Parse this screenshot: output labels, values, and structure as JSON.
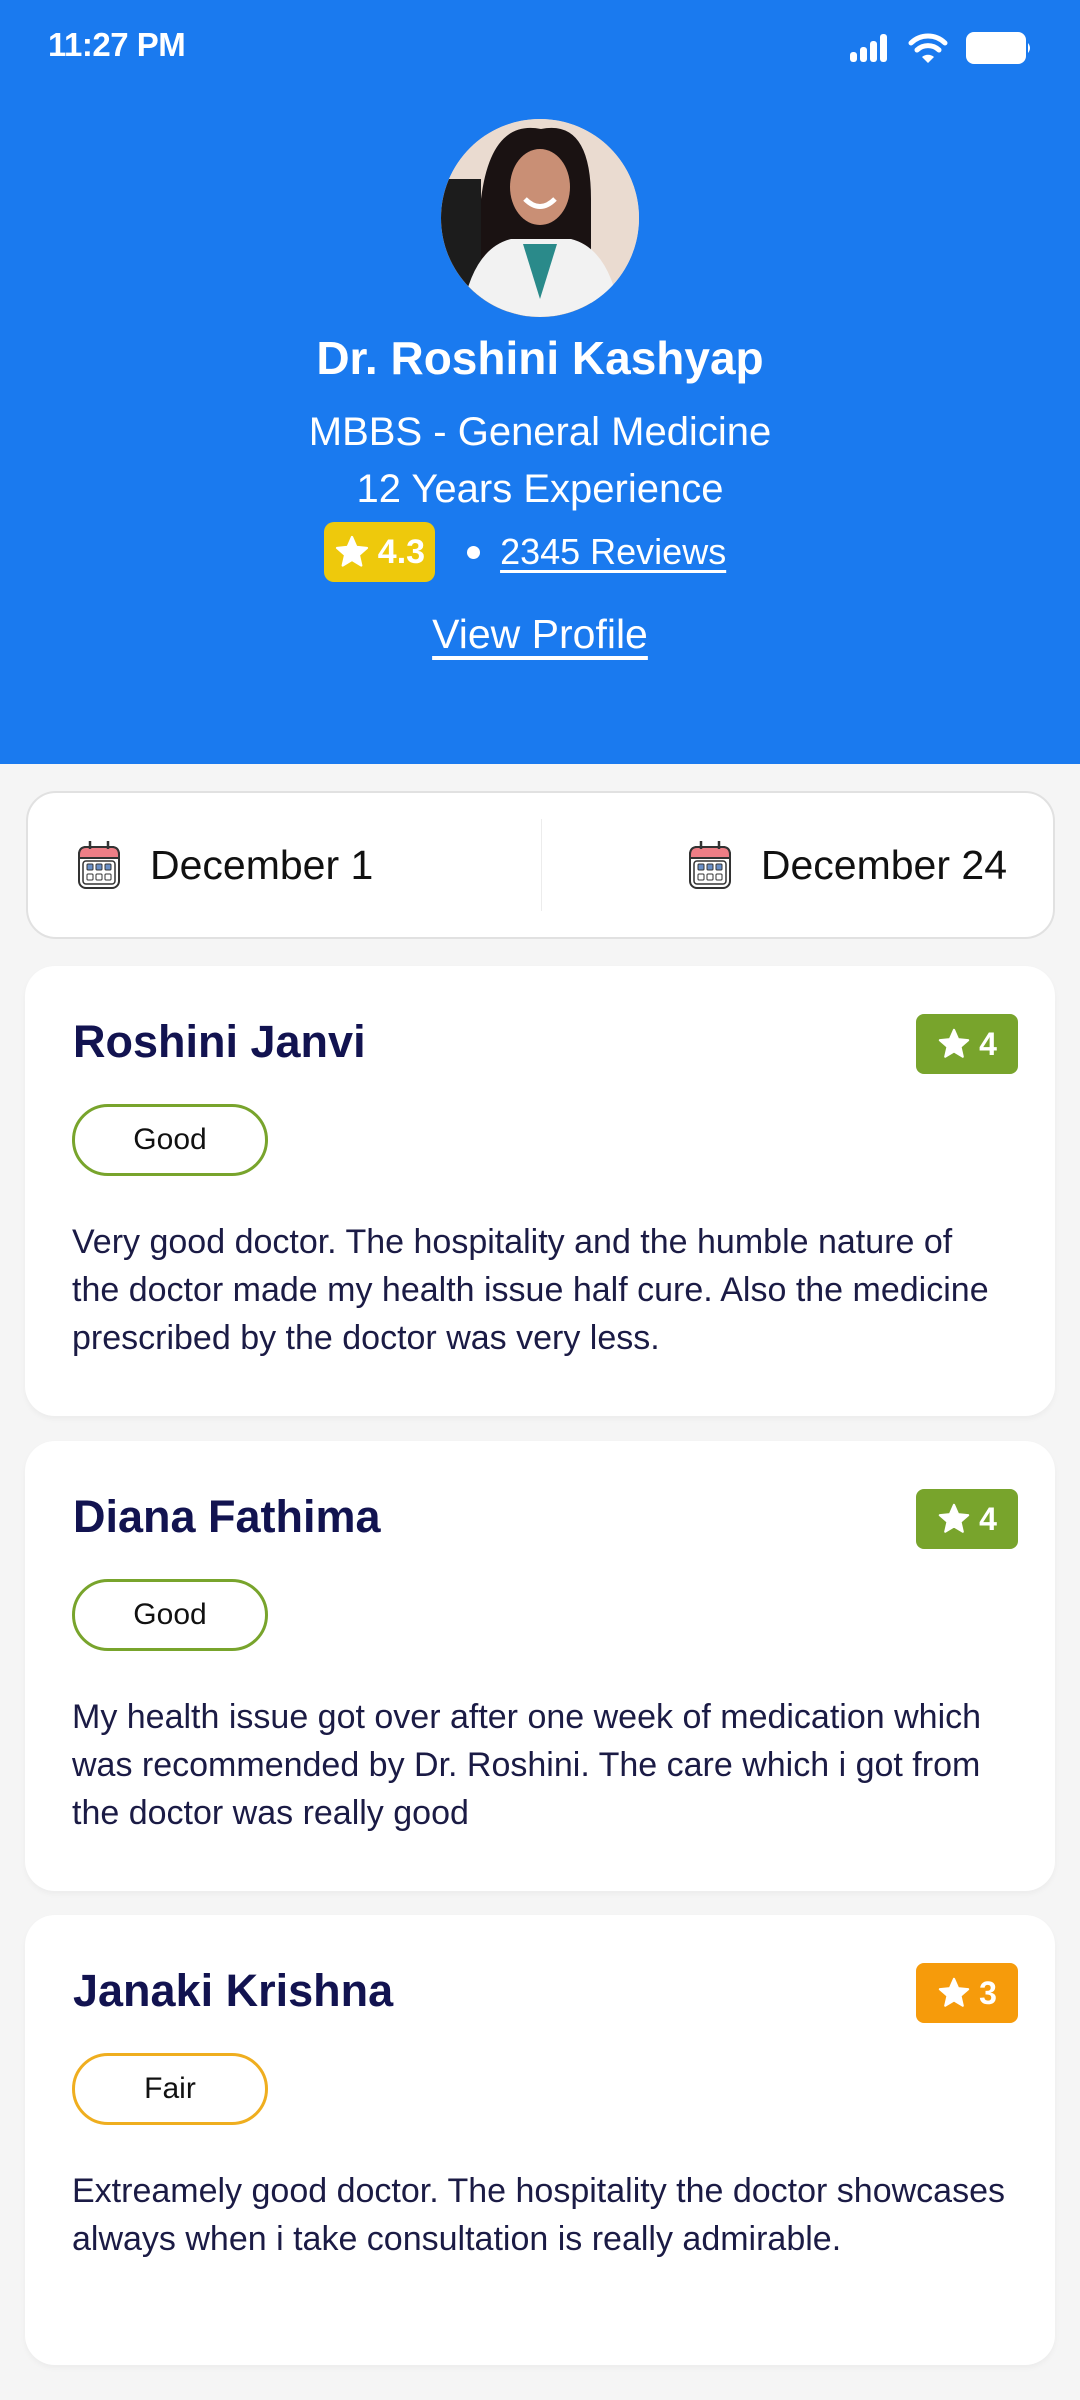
{
  "status_bar": {
    "time": "11:27 PM",
    "icons": [
      "signal-icon",
      "wifi-icon",
      "battery-icon"
    ]
  },
  "doctor": {
    "name": "Dr. Roshini Kashyap",
    "degree": "MBBS - General Medicine",
    "experience": "12 Years Experience",
    "rating": "4.3",
    "reviews_link": "2345 Reviews",
    "view_profile": "View Profile"
  },
  "date_range": {
    "from": "December 1",
    "to": "December 24"
  },
  "colors": {
    "header_bg": "#1a7aef",
    "rating_yellow": "#eec90c",
    "good_green": "#78a42c",
    "fair_orange": "#f69b0b",
    "name_navy": "#121350"
  },
  "reviews": [
    {
      "name": "Roshini Janvi",
      "score": "4",
      "tag": "Good",
      "text": "Very good doctor. The hospitality and the humble nature of the doctor made my health issue half cure. Also the medicine prescribed by the doctor was very less."
    },
    {
      "name": "Diana Fathima",
      "score": "4",
      "tag": "Good",
      "text": "My health issue got over after one week of medication which was recommended by Dr. Roshini. The care which i got from the doctor was really good"
    },
    {
      "name": "Janaki Krishna",
      "score": "3",
      "tag": "Fair",
      "text": "Extreamely good doctor. The hospitality the doctor showcases always when i take consultation is really admirable."
    }
  ]
}
